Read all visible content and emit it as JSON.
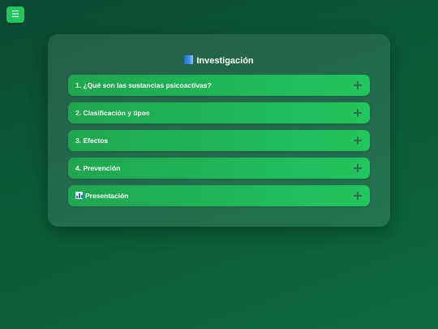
{
  "menu_button": {
    "icon": "hamburger-icon",
    "label": "☰"
  },
  "panel": {
    "title": "Investigación",
    "title_icon": "blue-book-icon",
    "items": [
      {
        "label": "1. ¿Qué son las sustancias psicoactivas?",
        "icon": "plus-icon"
      },
      {
        "label": "2. Clasificación y tipos",
        "icon": "plus-icon"
      },
      {
        "label": "3. Efectos",
        "icon": "plus-icon"
      },
      {
        "label": "4. Prevención",
        "icon": "plus-icon"
      },
      {
        "label": "Presentación",
        "leading_icon": "bar-chart-icon",
        "icon": "plus-icon"
      }
    ]
  },
  "colors": {
    "background": "#0b5a38",
    "accent": "#22c55e",
    "plus": "#2f6b45",
    "text": "#ffffff"
  }
}
